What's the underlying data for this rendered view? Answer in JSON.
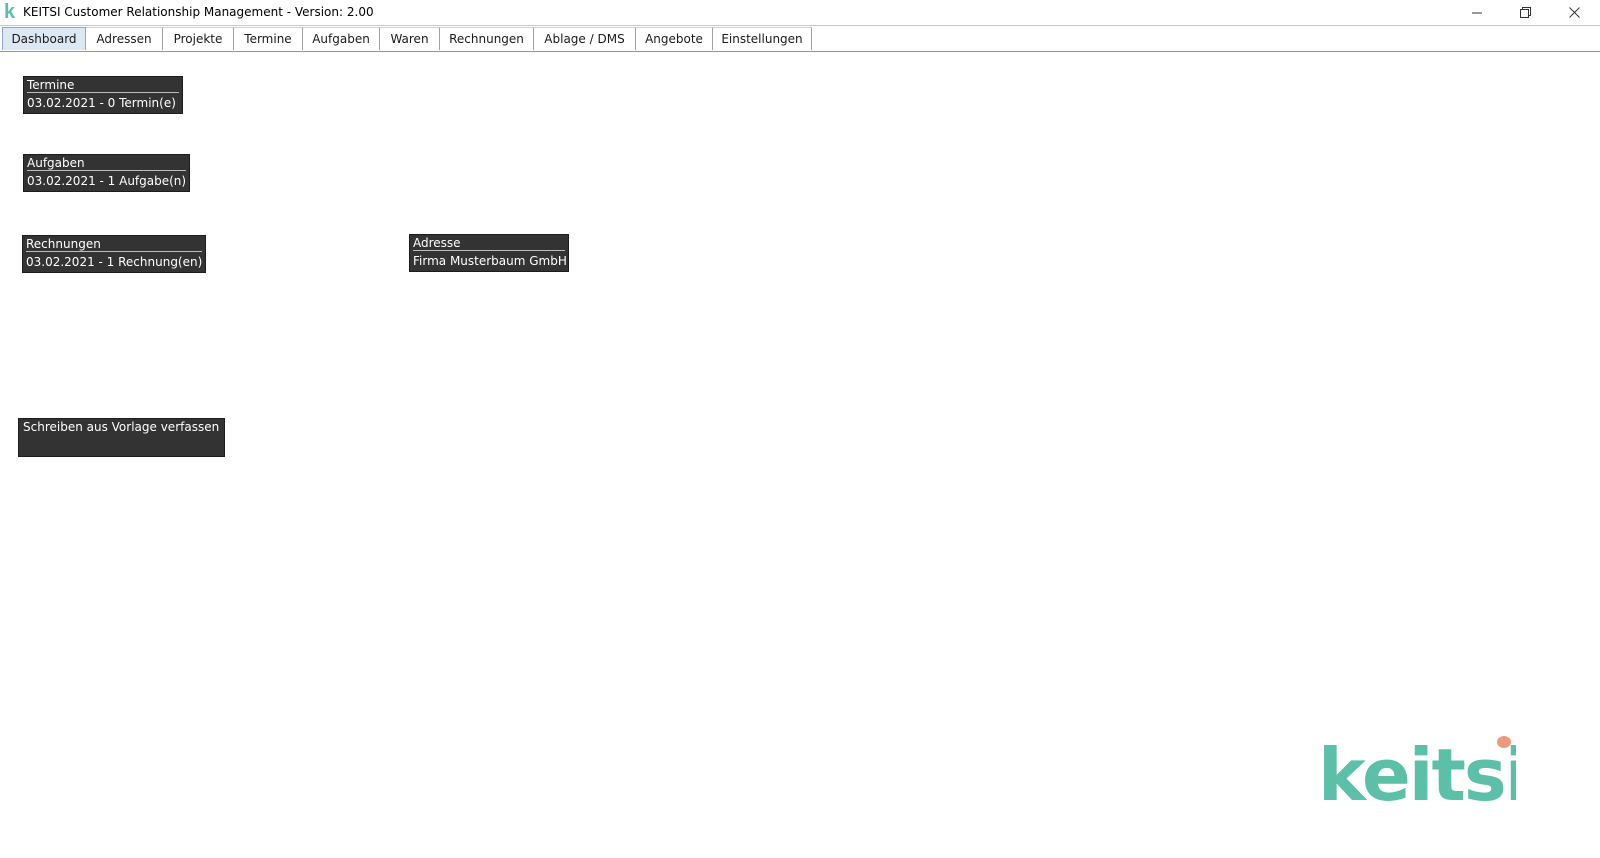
{
  "window": {
    "title": "KEITSI Customer Relationship Management - Version: 2.00",
    "app_icon_glyph": "k",
    "controls": [
      "minimize-icon",
      "restore-icon",
      "close-icon"
    ]
  },
  "tabs": [
    {
      "label": "Dashboard",
      "active": true
    },
    {
      "label": "Adressen",
      "active": false
    },
    {
      "label": "Projekte",
      "active": false
    },
    {
      "label": "Termine",
      "active": false
    },
    {
      "label": "Aufgaben",
      "active": false
    },
    {
      "label": "Waren",
      "active": false
    },
    {
      "label": "Rechnungen",
      "active": false
    },
    {
      "label": "Ablage / DMS",
      "active": false
    },
    {
      "label": "Angebote",
      "active": false
    },
    {
      "label": "Einstellungen",
      "active": false
    }
  ],
  "dashboard": {
    "termine": {
      "title": "Termine",
      "value": "03.02.2021 - 0 Termin(e)"
    },
    "aufgaben": {
      "title": "Aufgaben",
      "value": "03.02.2021 - 1 Aufgabe(n)"
    },
    "rechnungen": {
      "title": "Rechnungen",
      "value": "03.02.2021 - 1 Rechnung(en)"
    },
    "adresse": {
      "title": "Adresse",
      "value": "Firma Musterbaum GmbH"
    },
    "template_button": "Schreiben aus Vorlage verfassen"
  },
  "logo": {
    "text": "keitsi",
    "color": "#5cbfa8",
    "accent_color": "#f0987c"
  },
  "colors": {
    "widget_bg": "#333333",
    "active_tab_bg": "#dde8f5",
    "tab_underline": "#9b8bc9"
  }
}
